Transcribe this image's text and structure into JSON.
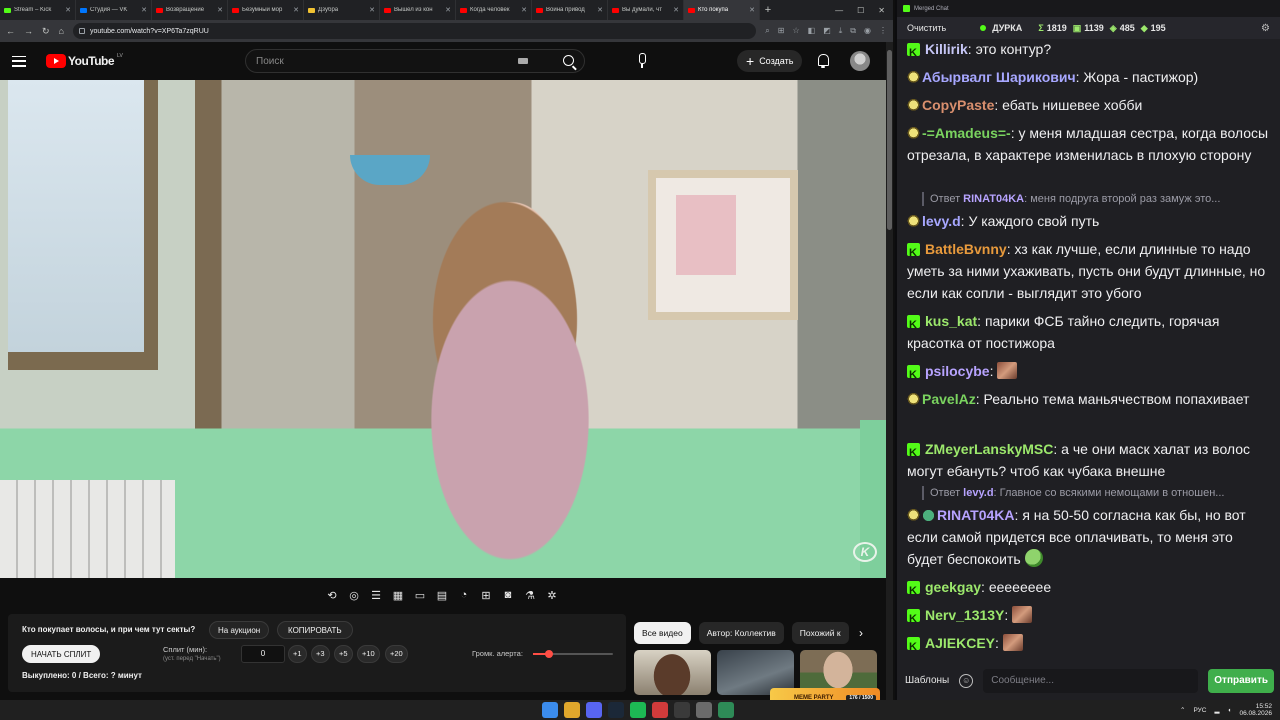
{
  "browser": {
    "tabs": [
      {
        "title": "Stream – Kick",
        "icon": "kick"
      },
      {
        "title": "Студия — VK",
        "icon": "vk"
      },
      {
        "title": "Возвращение",
        "icon": "yt"
      },
      {
        "title": "Безумный мор",
        "icon": "yt"
      },
      {
        "title": "Дзубра",
        "icon": "note"
      },
      {
        "title": "Вышел из кон",
        "icon": "yt"
      },
      {
        "title": "Когда человек",
        "icon": "yt"
      },
      {
        "title": "Война привод",
        "icon": "yt"
      },
      {
        "title": "Вы думали, чт",
        "icon": "yt"
      },
      {
        "title": "Кто покупа",
        "icon": "yt"
      }
    ],
    "url": "youtube.com/watch?v=XP6Ta7zqRUU"
  },
  "youtube": {
    "logo_text": "YouTube",
    "logo_country": "LV",
    "search_placeholder": "Поиск",
    "create_label": "Создать"
  },
  "auction": {
    "question": "Кто покупает волосы, и при чем тут секты?",
    "on_auction_label": "На аукцион",
    "copy_label": "КОПИРОВАТЬ",
    "start_split_label": "НАЧАТЬ СПЛИТ",
    "split_label": "Сплит (мин):",
    "split_sub": "(уст. перед \"Начать\")",
    "split_value": "0",
    "increments": [
      "+1",
      "+3",
      "+5",
      "+10",
      "+20"
    ],
    "volume_label": "Громк. алерта:",
    "volume_level": 0.2,
    "bought_text": "Выкуплено: 0 / Всего: ? минут"
  },
  "related": {
    "chips": [
      "Все видео",
      "Автор: Коллектив",
      "Похожий к"
    ]
  },
  "overlay": {
    "meme_party": "MEME PARTY",
    "meme_count": "176 / 1500"
  },
  "chat": {
    "window_title": "Merged Chat",
    "clear_label": "Очистить",
    "channel": "ДУРКА",
    "stats": {
      "total": "1819",
      "kick": "1139",
      "twitch": "485",
      "other": "195"
    },
    "messages": [
      {
        "badge": "kick",
        "nick": "Killirik",
        "color": "#c6c6f5",
        "text": "это контур?"
      },
      {
        "badge": "tw",
        "nick": "Абырвалг Шарикович",
        "color": "#a7a7ff",
        "text": "Жора - пастижор)"
      },
      {
        "badge": "tw",
        "nick": "CopyPaste",
        "color": "#d98f6e",
        "text": "ебать нишевее хобби"
      },
      {
        "badge": "tw",
        "nick": "-=Amadeus=-",
        "color": "#7ad35f",
        "text": "у меня младшая сестра, когда волосы отрезала, в характере изменилась в плохую сторону"
      },
      {
        "badge": "tw",
        "nick": "levy.d",
        "color": "#a7a7ff",
        "text": "У каждого свой путь",
        "reply_to": "RINAT04KA",
        "reply_text": "меня подруга второй раз замуж это..."
      },
      {
        "badge": "kick",
        "nick": "BattleBvnny",
        "color": "#e89a3c",
        "text": "хз как лучше, если длинные то надо уметь за ними ухаживать, пусть они будут длинные, но если как сопли - выглядит это убого"
      },
      {
        "badge": "kick",
        "nick": "kus_kat",
        "color": "#9ce86c",
        "text": "парики ФСБ тайно следить, горячая красотка от постижора"
      },
      {
        "badge": "kick",
        "nick": "psilocybe",
        "color": "#b7a3ff",
        "text": "",
        "emote": "face"
      },
      {
        "badge": "tw",
        "nick": "PavelAz",
        "color": "#7ad35f",
        "text": "Реально тема маньячеством попахивает"
      },
      {
        "badge": "kick",
        "nick": "ZMeyerLanskyMSC",
        "color": "#9ce86c",
        "text": "а че они маск халат из волос могут ебануть? чтоб как чубака внешне",
        "reply_to": "levy.d",
        "reply_text": "Главное со всякими немощами в отношен..."
      },
      {
        "badge": "tw",
        "badge2": "ok",
        "nick": "RINAT04KA",
        "color": "#b7a3ff",
        "text": "я на 50-50 согласна как бы, но вот если самой придется все оплачивать, то меня это будет беспокоить",
        "emote": "frog"
      },
      {
        "badge": "kick",
        "nick": "geekgay",
        "color": "#9ce86c",
        "text": "ееееееее"
      },
      {
        "badge": "kick",
        "nick": "Nerv_1313Y",
        "color": "#9ce86c",
        "text": "",
        "emote": "face"
      },
      {
        "badge": "kick",
        "nick": "AJIEKCEY",
        "color": "#9ce86c",
        "text": "",
        "emote": "face"
      }
    ],
    "templates_label": "Шаблоны",
    "input_placeholder": "Сообщение...",
    "send_label": "Отправить"
  },
  "taskbar": {
    "lang": "РУС",
    "time": "15:52",
    "date": "06.08.2026"
  }
}
